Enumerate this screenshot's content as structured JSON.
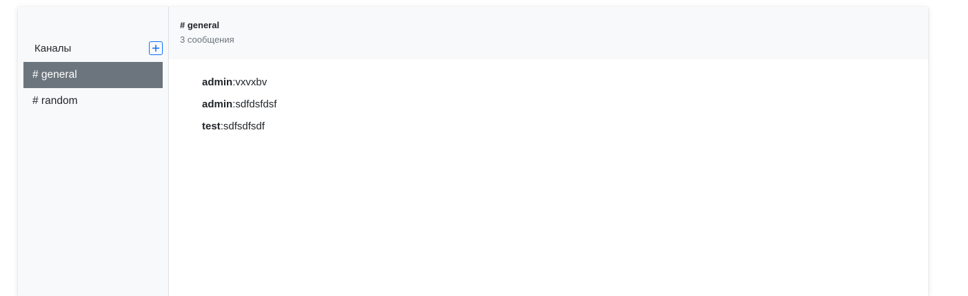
{
  "sidebar": {
    "title": "Каналы",
    "add_icon": "plus-square-icon",
    "channels": [
      {
        "label": "# general",
        "active": true
      },
      {
        "label": "# random",
        "active": false
      }
    ]
  },
  "chat": {
    "title": "# general",
    "count": "3 сообщения",
    "messages": [
      {
        "author": "admin",
        "separator": ":",
        "text": "vxvxbv"
      },
      {
        "author": "admin",
        "separator": ":",
        "text": "sdfdsfdsf"
      },
      {
        "author": "test",
        "separator": ":",
        "text": "sdfsdfsdf"
      }
    ]
  },
  "colors": {
    "accent": "#0d6efd",
    "active_channel_bg": "#6c757d",
    "sidebar_bg": "#f8f9fa"
  }
}
